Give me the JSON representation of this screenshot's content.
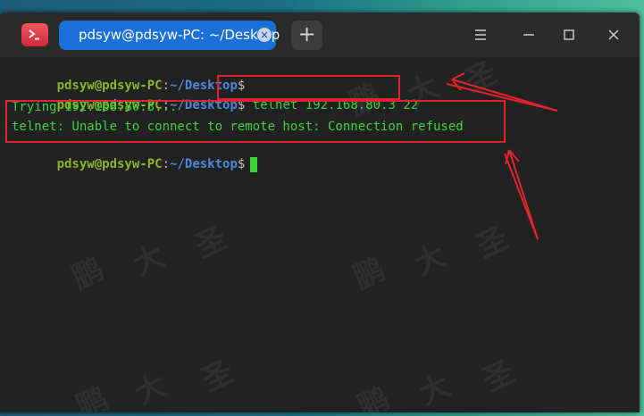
{
  "window": {
    "tab_title": "pdsyw@pdsyw-PC: ~/Desktop",
    "tab_close_glyph": "×",
    "new_tab_glyph": "+"
  },
  "terminal": {
    "prompt_user": "pdsyw@pdsyw-PC",
    "prompt_colon": ":",
    "prompt_path": "~/Desktop",
    "prompt_dollar": "$",
    "command": "telnet 192.168.80.3 22",
    "output_1": "Trying 192.168.80.3...",
    "output_2": "telnet: Unable to connect to remote host: Connection refused"
  },
  "watermark": {
    "chars": [
      "鹏",
      "大",
      "圣"
    ]
  },
  "colors": {
    "tab_active": "#1a6fd8",
    "prompt_user": "#89b528",
    "prompt_path": "#4a88d9",
    "terminal_text": "#3cd43c",
    "annotation": "#e0262c"
  },
  "icons": {
    "app": "terminal-app-icon",
    "menu": "hamburger-menu-icon",
    "minimize": "minimize-icon",
    "maximize": "maximize-icon",
    "close": "close-icon"
  }
}
